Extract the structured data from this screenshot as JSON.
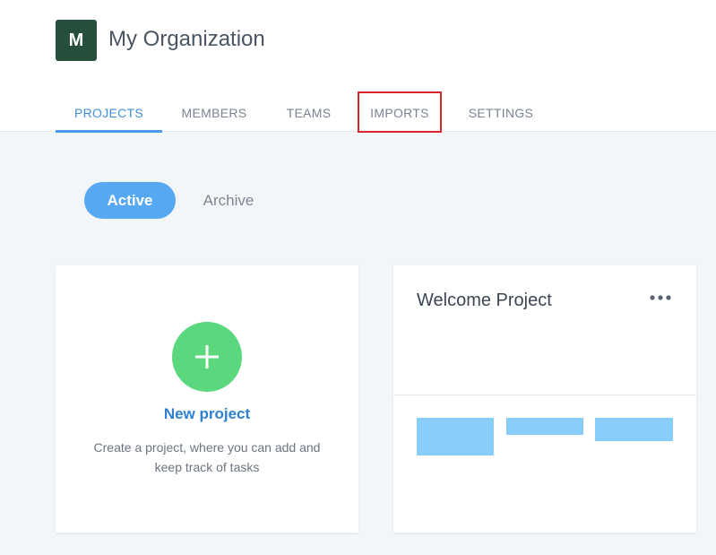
{
  "org": {
    "avatar_letter": "M",
    "name": "My Organization"
  },
  "tabs": [
    {
      "label": "PROJECTS",
      "active": true
    },
    {
      "label": "MEMBERS",
      "active": false
    },
    {
      "label": "TEAMS",
      "active": false
    },
    {
      "label": "IMPORTS",
      "active": false,
      "highlighted": true
    },
    {
      "label": "SETTINGS",
      "active": false
    }
  ],
  "filters": {
    "active_label": "Active",
    "archive_label": "Archive",
    "selected": "Active"
  },
  "new_project_card": {
    "title": "New project",
    "description": "Create a project, where you can add and keep track of tasks"
  },
  "welcome_card": {
    "title": "Welcome Project"
  },
  "icons": {
    "plus": "plus-icon",
    "more": "more-horizontal-icon"
  },
  "colors": {
    "accent": "#4a9ae8",
    "avatar_bg": "#264f3b",
    "plus_green": "#5bd77d",
    "highlight_red": "#d9262c",
    "board_blue": "#88ccf8"
  }
}
